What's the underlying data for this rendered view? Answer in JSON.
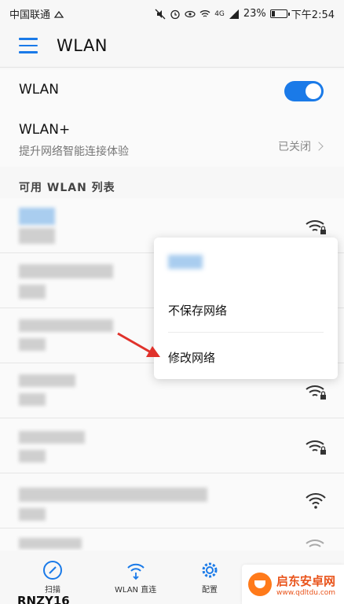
{
  "status": {
    "carrier": "中国联通",
    "network_type": "4G",
    "battery": "23%",
    "battery_level": 0.23,
    "time": "下午2:54"
  },
  "app_bar": {
    "title": "WLAN"
  },
  "wlan_row": {
    "label": "WLAN",
    "enabled": true
  },
  "wlan_plus_row": {
    "label": "WLAN+",
    "sublabel": "提升网络智能连接体验",
    "status": "已关闭"
  },
  "section": {
    "available_header": "可用 WLAN 列表"
  },
  "networks": [
    {
      "icon": "wifi-locked-icon"
    },
    {
      "icon": "wifi-locked-icon"
    },
    {
      "icon": "wifi-locked-icon"
    },
    {
      "icon": "wifi-locked-icon"
    },
    {
      "icon": "wifi-locked-icon"
    },
    {
      "icon": "wifi-icon"
    },
    {
      "icon": "wifi-locked-icon"
    }
  ],
  "popup": {
    "forget": "不保存网络",
    "modify": "修改网络"
  },
  "bottom_nav": {
    "scan": "扫描",
    "wifi_direct": "WLAN 直连",
    "config": "配置"
  },
  "bottom_partial": {
    "ssid_text": "RNZY16"
  },
  "watermark": {
    "title": "启东安卓网",
    "url": "www.qdltdu.com"
  },
  "colors": {
    "accent": "#1a7ae8",
    "arrow": "#e0322b"
  }
}
